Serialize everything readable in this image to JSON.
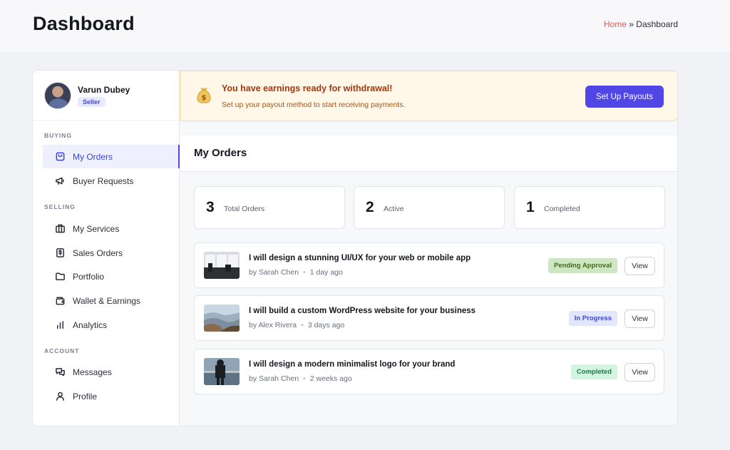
{
  "header": {
    "title": "Dashboard",
    "breadcrumb_home": "Home",
    "breadcrumb_sep": " » ",
    "breadcrumb_current": "Dashboard"
  },
  "profile": {
    "name": "Varun Dubey",
    "role": "Seller"
  },
  "sidebar": {
    "sections": {
      "buying": "BUYING",
      "selling": "SELLING",
      "account": "ACCOUNT"
    },
    "items": [
      {
        "label": "My Orders",
        "icon": "shopping-bag-icon",
        "active": true
      },
      {
        "label": "Buyer Requests",
        "icon": "megaphone-icon"
      },
      {
        "label": "My Services",
        "icon": "briefcase-icon"
      },
      {
        "label": "Sales Orders",
        "icon": "dollar-receipt-icon"
      },
      {
        "label": "Portfolio",
        "icon": "folder-icon"
      },
      {
        "label": "Wallet & Earnings",
        "icon": "wallet-icon"
      },
      {
        "label": "Analytics",
        "icon": "bar-chart-icon"
      },
      {
        "label": "Messages",
        "icon": "chat-bubbles-icon"
      },
      {
        "label": "Profile",
        "icon": "user-icon"
      }
    ]
  },
  "alert": {
    "icon": "money-bag-icon",
    "title": "You have earnings ready for withdrawal!",
    "description": "Set up your payout method to start receiving payments.",
    "button": "Set Up Payouts"
  },
  "orders": {
    "title": "My Orders",
    "stats": [
      {
        "value": "3",
        "label": "Total Orders"
      },
      {
        "value": "2",
        "label": "Active"
      },
      {
        "value": "1",
        "label": "Completed"
      }
    ],
    "items": [
      {
        "title": "I will design a stunning UI/UX for your web or mobile app",
        "seller": "by Sarah Chen",
        "time": "1 day ago",
        "status": "Pending Approval",
        "status_bg": "#cfe6c2",
        "status_color": "#3f6a1f",
        "action": "View"
      },
      {
        "title": "I will build a custom WordPress website for your business",
        "seller": "by Alex Rivera",
        "time": "3 days ago",
        "status": "In Progress",
        "status_bg": "#e3e6ff",
        "status_color": "#3b48d6",
        "action": "View"
      },
      {
        "title": "I will design a modern minimalist logo for your brand",
        "seller": "by Sarah Chen",
        "time": "2 weeks ago",
        "status": "Completed",
        "status_bg": "#d2f5df",
        "status_color": "#18794a",
        "action": "View"
      }
    ]
  },
  "colors": {
    "accent": "#4f46e5",
    "home_link": "#e8584e",
    "alert_title": "#a4380c"
  }
}
